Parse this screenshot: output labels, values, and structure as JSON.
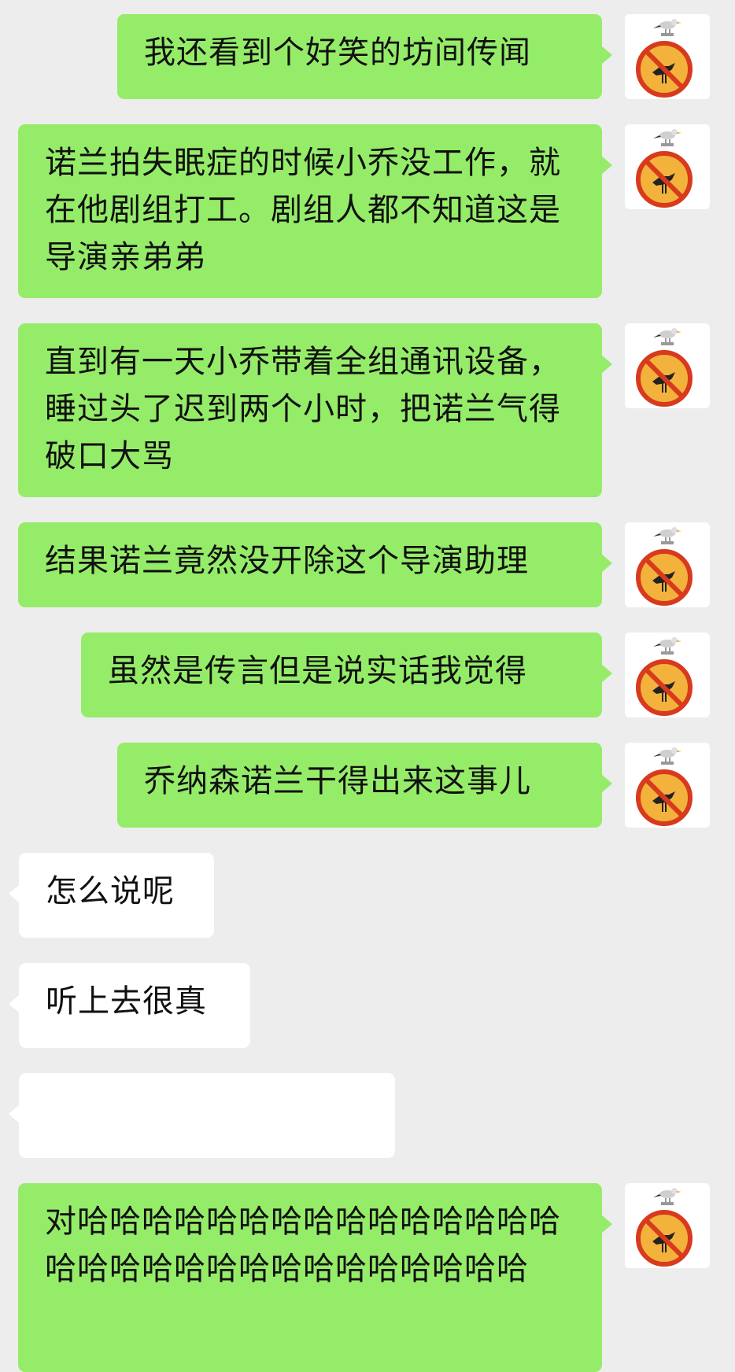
{
  "chat": {
    "messages": [
      {
        "side": "out",
        "text": "我还看到个好笑的坊间传闻",
        "avatar_icon": "no-bird-icon"
      },
      {
        "side": "out",
        "text": "诺兰拍失眠症的时候小乔没工作，就在他剧组打工。剧组人都不知道这是导演亲弟弟",
        "avatar_icon": "no-bird-icon"
      },
      {
        "side": "out",
        "text": "直到有一天小乔带着全组通讯设备，睡过头了迟到两个小时，把诺兰气得破口大骂",
        "avatar_icon": "no-bird-icon"
      },
      {
        "side": "out",
        "text": "结果诺兰竟然没开除这个导演助理",
        "avatar_icon": "no-bird-icon"
      },
      {
        "side": "out",
        "text": "虽然是传言但是说实话我觉得",
        "avatar_icon": "no-bird-icon"
      },
      {
        "side": "out",
        "text": "乔纳森诺兰干得出来这事儿",
        "avatar_icon": "no-bird-icon"
      },
      {
        "side": "in",
        "text": "怎么说呢"
      },
      {
        "side": "in",
        "text": "听上去很真"
      },
      {
        "side": "in",
        "text": "",
        "obscured": true
      },
      {
        "side": "out",
        "text": "对哈哈哈哈哈哈哈哈哈哈哈哈哈哈哈哈哈哈哈哈哈哈哈哈哈哈哈哈哈哈",
        "avatar_icon": "no-bird-icon"
      }
    ]
  },
  "colors": {
    "background": "#ededed",
    "outgoing_bubble": "#95ec69",
    "incoming_bubble": "#ffffff",
    "text": "#111111",
    "prohibition_ring": "#d83a1e",
    "prohibition_fill": "#f3b23c"
  }
}
